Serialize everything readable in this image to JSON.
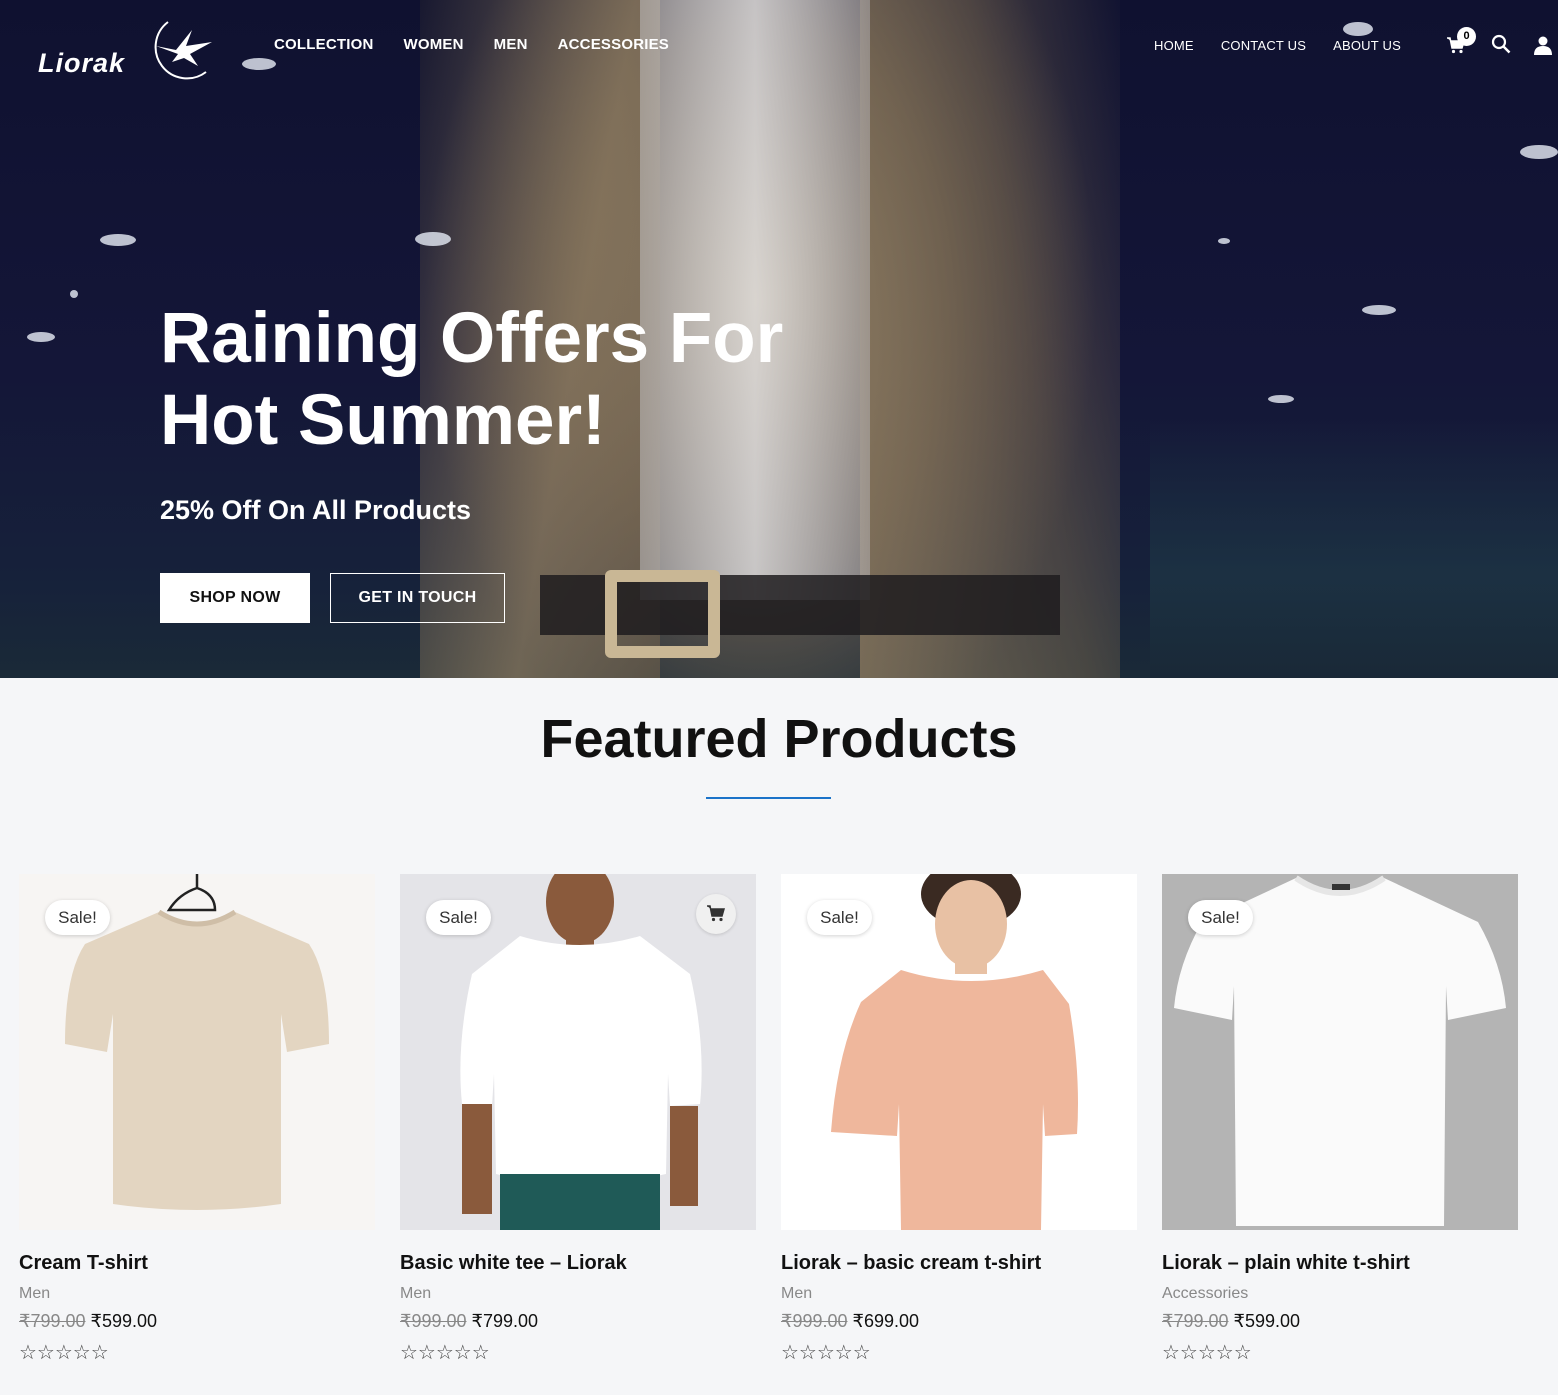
{
  "brand": {
    "name": "Liorak"
  },
  "nav": {
    "main": [
      "COLLECTION",
      "WOMEN",
      "MEN",
      "ACCESSORIES"
    ],
    "right": [
      "HOME",
      "CONTACT US",
      "ABOUT US"
    ],
    "cart_count": "0",
    "icons": [
      "cart-icon",
      "search-icon",
      "user-icon"
    ]
  },
  "hero": {
    "title_line1": "Raining Offers For",
    "title_line2": "Hot Summer!",
    "subtitle": "25% Off On All Products",
    "primary_button": "SHOP NOW",
    "secondary_button": "GET IN TOUCH"
  },
  "featured": {
    "title": "Featured Products",
    "accent_color": "#1b73c9",
    "products": [
      {
        "badge": "Sale!",
        "name": "Cream T-shirt",
        "category": "Men",
        "old_price": "₹799.00",
        "price": "₹599.00",
        "stars": "☆☆☆☆☆"
      },
      {
        "badge": "Sale!",
        "name": "Basic white tee – Liorak",
        "category": "Men",
        "old_price": "₹999.00",
        "price": "₹799.00",
        "stars": "☆☆☆☆☆"
      },
      {
        "badge": "Sale!",
        "name": "Liorak – basic cream t-shirt",
        "category": "Men",
        "old_price": "₹999.00",
        "price": "₹699.00",
        "stars": "☆☆☆☆☆"
      },
      {
        "badge": "Sale!",
        "name": "Liorak – plain white t-shirt",
        "category": "Accessories",
        "old_price": "₹799.00",
        "price": "₹599.00",
        "stars": "☆☆☆☆☆"
      }
    ]
  }
}
